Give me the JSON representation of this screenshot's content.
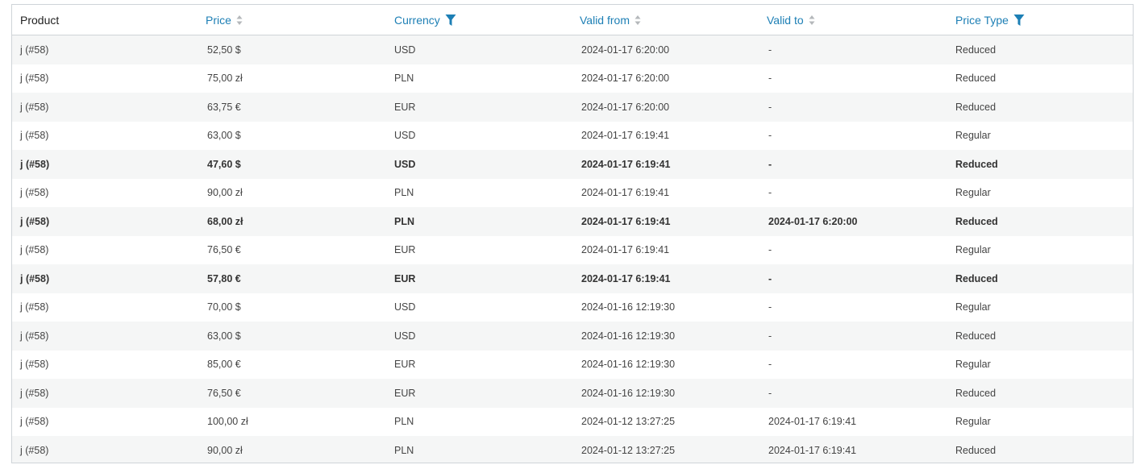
{
  "table": {
    "headers": {
      "product": "Product",
      "price": "Price",
      "currency": "Currency",
      "valid_from": "Valid from",
      "valid_to": "Valid to",
      "price_type": "Price Type"
    },
    "header_icons": {
      "price": "sort-icon",
      "currency": "filter-icon",
      "valid_from": "sort-icon",
      "valid_to": "sort-icon",
      "price_type": "filter-icon"
    },
    "colors": {
      "accent": "#1d7fb5",
      "row_alt": "#f5f6f6",
      "border": "#cfd4d8"
    },
    "rows": [
      {
        "product": "j (#58)",
        "price": "52,50 $",
        "currency": "USD",
        "valid_from": "2024-01-17 6:20:00",
        "valid_to": "-",
        "price_type": "Reduced",
        "bold": false
      },
      {
        "product": "j (#58)",
        "price": "75,00 zł",
        "currency": "PLN",
        "valid_from": "2024-01-17 6:20:00",
        "valid_to": "-",
        "price_type": "Reduced",
        "bold": false
      },
      {
        "product": "j (#58)",
        "price": "63,75 €",
        "currency": "EUR",
        "valid_from": "2024-01-17 6:20:00",
        "valid_to": "-",
        "price_type": "Reduced",
        "bold": false
      },
      {
        "product": "j (#58)",
        "price": "63,00 $",
        "currency": "USD",
        "valid_from": "2024-01-17 6:19:41",
        "valid_to": "-",
        "price_type": "Regular",
        "bold": false
      },
      {
        "product": "j (#58)",
        "price": "47,60 $",
        "currency": "USD",
        "valid_from": "2024-01-17 6:19:41",
        "valid_to": "-",
        "price_type": "Reduced",
        "bold": true
      },
      {
        "product": "j (#58)",
        "price": "90,00 zł",
        "currency": "PLN",
        "valid_from": "2024-01-17 6:19:41",
        "valid_to": "-",
        "price_type": "Regular",
        "bold": false
      },
      {
        "product": "j (#58)",
        "price": "68,00 zł",
        "currency": "PLN",
        "valid_from": "2024-01-17 6:19:41",
        "valid_to": "2024-01-17 6:20:00",
        "price_type": "Reduced",
        "bold": true
      },
      {
        "product": "j (#58)",
        "price": "76,50 €",
        "currency": "EUR",
        "valid_from": "2024-01-17 6:19:41",
        "valid_to": "-",
        "price_type": "Regular",
        "bold": false
      },
      {
        "product": "j (#58)",
        "price": "57,80 €",
        "currency": "EUR",
        "valid_from": "2024-01-17 6:19:41",
        "valid_to": "-",
        "price_type": "Reduced",
        "bold": true
      },
      {
        "product": "j (#58)",
        "price": "70,00 $",
        "currency": "USD",
        "valid_from": "2024-01-16 12:19:30",
        "valid_to": "-",
        "price_type": "Regular",
        "bold": false
      },
      {
        "product": "j (#58)",
        "price": "63,00 $",
        "currency": "USD",
        "valid_from": "2024-01-16 12:19:30",
        "valid_to": "-",
        "price_type": "Reduced",
        "bold": false
      },
      {
        "product": "j (#58)",
        "price": "85,00 €",
        "currency": "EUR",
        "valid_from": "2024-01-16 12:19:30",
        "valid_to": "-",
        "price_type": "Regular",
        "bold": false
      },
      {
        "product": "j (#58)",
        "price": "76,50 €",
        "currency": "EUR",
        "valid_from": "2024-01-16 12:19:30",
        "valid_to": "-",
        "price_type": "Reduced",
        "bold": false
      },
      {
        "product": "j (#58)",
        "price": "100,00 zł",
        "currency": "PLN",
        "valid_from": "2024-01-12 13:27:25",
        "valid_to": "2024-01-17 6:19:41",
        "price_type": "Regular",
        "bold": false
      },
      {
        "product": "j (#58)",
        "price": "90,00 zł",
        "currency": "PLN",
        "valid_from": "2024-01-12 13:27:25",
        "valid_to": "2024-01-17 6:19:41",
        "price_type": "Reduced",
        "bold": false
      }
    ]
  }
}
